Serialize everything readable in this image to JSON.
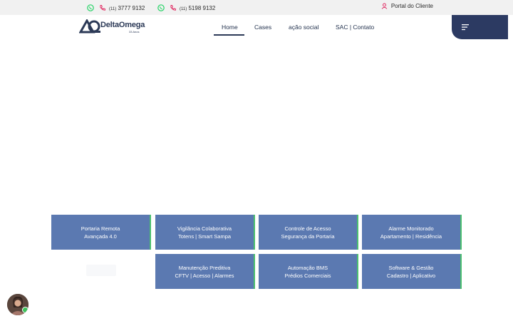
{
  "topbar": {
    "phone1": {
      "ddd": "(11)",
      "number": "3777 9132"
    },
    "phone2": {
      "ddd": "(11)",
      "number": "5198 9132"
    },
    "portal_label": "Portal do Cliente"
  },
  "brand": {
    "name": "DeltaOmega",
    "tagline": "33 Anos"
  },
  "nav": [
    {
      "label": "Home",
      "active": true
    },
    {
      "label": "Cases",
      "active": false
    },
    {
      "label": "ação social",
      "active": false
    },
    {
      "label": "SAC | Contato",
      "active": false
    }
  ],
  "services": [
    {
      "line1": "Portaria Remota",
      "line2": "Avançada 4.0"
    },
    {
      "line1": "Vigilância Colaborativa",
      "line2": "Totens | Smart Sampa"
    },
    {
      "line1": "Controle de Acesso",
      "line2": "Segurança da Portaria"
    },
    {
      "line1": "Alarme Monitorado",
      "line2": "Apartamento | Residência"
    },
    {
      "line1": "Manutenção Preditiva",
      "line2": "CFTV | Acesso | Alarmes"
    },
    {
      "line1": "Automação BMS",
      "line2": "Prédios Comerciais"
    },
    {
      "line1": "Software & Gestão",
      "line2": "Cadastro | Aplicativo"
    }
  ],
  "colors": {
    "primary": "#2c3a62",
    "card": "#5b79b1",
    "accent": "#4cc06f",
    "whatsapp": "#25d366",
    "phone": "#e0245e"
  },
  "icons": [
    "whatsapp-icon",
    "phone-icon",
    "user-icon",
    "menu-icon"
  ]
}
